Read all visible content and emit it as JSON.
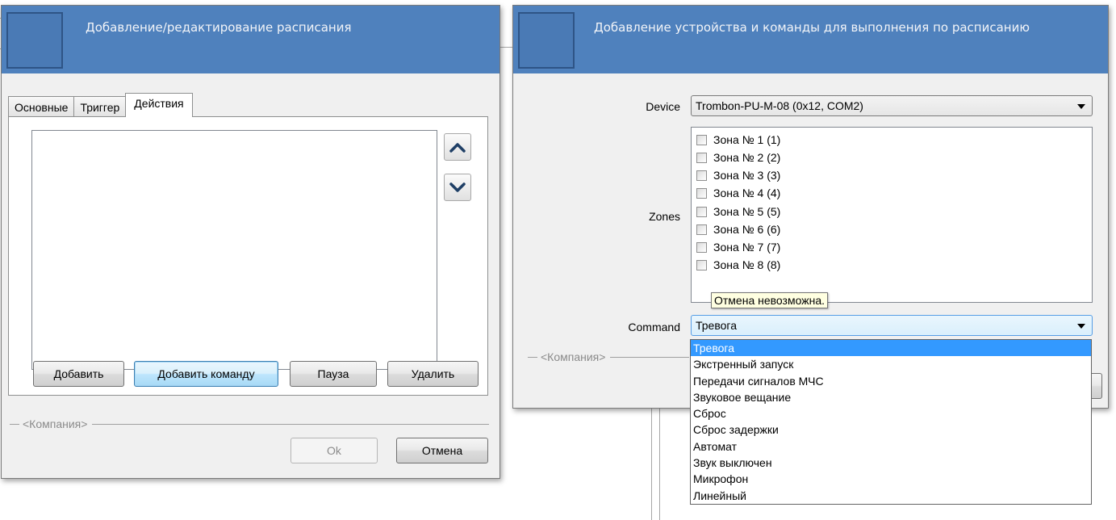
{
  "schedule_dialog": {
    "title": "Добавление/редактирование расписания",
    "tabs": [
      {
        "label": "Основные",
        "active": false
      },
      {
        "label": "Триггер",
        "active": false
      },
      {
        "label": "Действия",
        "active": true
      }
    ],
    "buttons": {
      "add": "Добавить",
      "add_command": "Добавить команду",
      "pause": "Пауза",
      "delete": "Удалить",
      "ok": "Ok",
      "cancel": "Отмена"
    },
    "company_label": "<Компания>",
    "icons": {
      "move_up": "chevron-up-icon",
      "move_down": "chevron-down-icon"
    }
  },
  "device_dialog": {
    "title": "Добавление устройства и команды для выполнения по расписанию",
    "device_label": "Device",
    "device_value": "Trombon-PU-M-08 (0x12, COM2)",
    "zones_label": "Zones",
    "zones": [
      {
        "label": "Зона № 1 (1)",
        "checked": false
      },
      {
        "label": "Зона № 2 (2)",
        "checked": false
      },
      {
        "label": "Зона № 3 (3)",
        "checked": false
      },
      {
        "label": "Зона № 4 (4)",
        "checked": false
      },
      {
        "label": "Зона № 5 (5)",
        "checked": false
      },
      {
        "label": "Зона № 6 (6)",
        "checked": false
      },
      {
        "label": "Зона № 7 (7)",
        "checked": false
      },
      {
        "label": "Зона № 8 (8)",
        "checked": false
      }
    ],
    "tooltip": "Отмена невозможна.",
    "command_label": "Command",
    "command_value": "Тревога",
    "command_options": [
      "Тревога",
      "Экстренный запуск",
      "Передачи сигналов МЧС",
      "Звуковое вещание",
      "Сброс",
      "Сброс задержки",
      "Автомат",
      "Звук выключен",
      "Микрофон",
      "Линейный"
    ],
    "selected_option_index": 0,
    "company_label": "<Компания>"
  },
  "colors": {
    "header": "#4f81bd",
    "dialog_bg": "#f0f0f0",
    "selection": "#3399ff",
    "tooltip_bg": "#ffffe1"
  }
}
